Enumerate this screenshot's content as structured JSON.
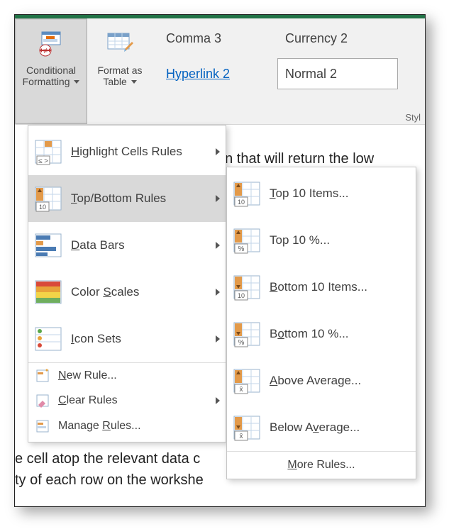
{
  "ribbon": {
    "conditional_formatting": {
      "line1": "Conditional",
      "line2": "Formatting"
    },
    "format_as_table": {
      "line1": "Format as",
      "line2": "Table"
    },
    "styles_label": "Styl",
    "gallery": {
      "comma3": "Comma 3",
      "currency2": "Currency 2",
      "hyperlink2": "Hyperlink 2",
      "normal2": "Normal 2"
    }
  },
  "bg": {
    "line1": "on that will return the low",
    "line2": "e cell atop the relevant data c",
    "line3": "ty of each row on the workshe"
  },
  "cf_menu": {
    "highlight_pre": "H",
    "highlight_post": "ighlight Cells Rules",
    "topbottom_pre": "T",
    "topbottom_post": "op/Bottom Rules",
    "databars_pre": "D",
    "databars_post": "ata Bars",
    "colorscales_pre": "Color ",
    "colorscales_mnem": "S",
    "colorscales_post": "cales",
    "iconsets_pre": "I",
    "iconsets_post": "con Sets",
    "newrule_pre": "N",
    "newrule_post": "ew Rule...",
    "clearrules_pre": "C",
    "clearrules_post": "lear Rules",
    "managerules_pre": "Manage ",
    "managerules_mnem": "R",
    "managerules_post": "ules..."
  },
  "tb_menu": {
    "top10items_pre": "T",
    "top10items_post": "op 10 Items...",
    "top10pct": "Top 10 %...",
    "bottom10items_pre": "B",
    "bottom10items_post": "ottom 10 Items...",
    "bottom10pct_pre": "B",
    "bottom10pct_mnem": "o",
    "bottom10pct_post": "ttom 10 %...",
    "aboveavg_pre": "A",
    "aboveavg_post": "bove Average...",
    "belowavg_pre": "Below A",
    "belowavg_mnem": "v",
    "belowavg_post": "erage...",
    "more_pre": "M",
    "more_post": "ore Rules..."
  }
}
